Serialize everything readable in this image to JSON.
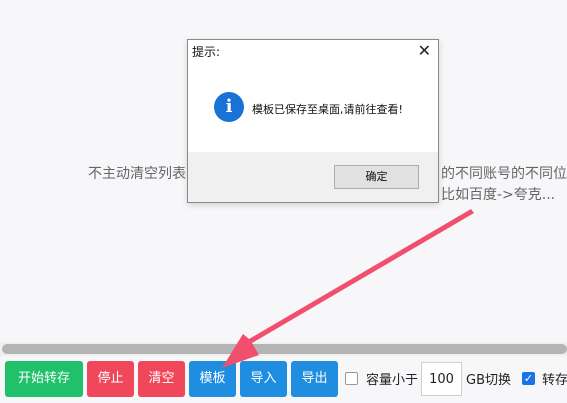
{
  "background": {
    "text_left": "不主动清空列表",
    "text_right_line1": "的不同账号的不同位",
    "text_right_line2": "比如百度->夸克..."
  },
  "dialog": {
    "title": "提示:",
    "close_symbol": "✕",
    "icon_glyph": "i",
    "message": "模板已保存至桌面,请前往查看!",
    "ok_label": "确定"
  },
  "toolbar": {
    "start_label": "开始转存",
    "stop_label": "停止",
    "clear_label": "清空",
    "template_label": "模板",
    "import_label": "导入",
    "export_label": "导出",
    "capacity_label": "容量小于",
    "capacity_value": "100",
    "gb_switch_label": "GB切换",
    "transfer_label": "转存",
    "capacity_checked": false,
    "transfer_checked": true,
    "check_glyph": "✓"
  },
  "colors": {
    "green": "#21c06a",
    "red": "#f0485a",
    "blue": "#1f8de0",
    "arrow": "#f0506e",
    "info_icon": "#1a72d6"
  },
  "icons": {
    "info": "info-icon",
    "close": "close-icon",
    "check": "check-icon",
    "annotation": "red-arrow-annotation"
  }
}
